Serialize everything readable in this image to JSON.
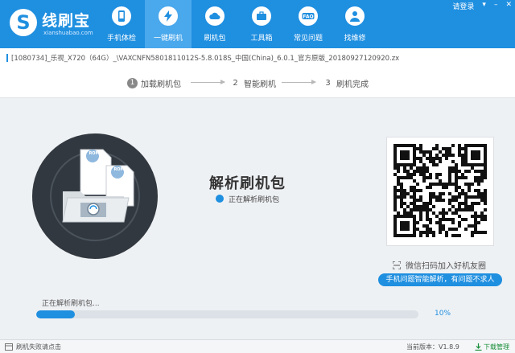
{
  "app": {
    "logo_glyph": "S",
    "title": "线刷宝",
    "subtitle": "xianshuabao.com"
  },
  "topbar": {
    "login": "请登录",
    "menu": "▾",
    "minimize": "–",
    "close": "✕"
  },
  "nav": [
    {
      "label": "手机体检",
      "icon": "phone-check-icon"
    },
    {
      "label": "一键刷机",
      "icon": "lightning-icon",
      "active": true
    },
    {
      "label": "刷机包",
      "icon": "cloud-icon"
    },
    {
      "label": "工具箱",
      "icon": "toolbox-icon"
    },
    {
      "label": "常见问题",
      "icon": "faq-icon"
    },
    {
      "label": "找维修",
      "icon": "person-icon"
    }
  ],
  "rom_path": "[1080734]_乐视_X720（64G）_\\VAXCNFN5801811012S-5.8.018S_中国(China)_6.0.1_官方原版_20180927120920.zx",
  "steps": [
    {
      "num": "1",
      "label": "加载刷机包"
    },
    {
      "num": "2",
      "label": "智能刷机"
    },
    {
      "num": "3",
      "label": "刷机完成"
    }
  ],
  "main": {
    "title": "解析刷机包",
    "status": "正在解析刷机包",
    "rom_badge": "ROM",
    "qr_caption": "微信扫码加入好机友圈",
    "qr_pill": "手机问题智能解析，有问题不求人",
    "progress_label": "正在解析刷机包...",
    "progress": 0.1,
    "progress_text": "10%"
  },
  "statusbar": {
    "left": "刷机失败请点击",
    "version": "当前版本：V1.8.9",
    "download": "下载管理"
  },
  "colors": {
    "primary": "#1f8fe0",
    "nav_active": "#4aa8ec",
    "disc": "#32383f"
  }
}
